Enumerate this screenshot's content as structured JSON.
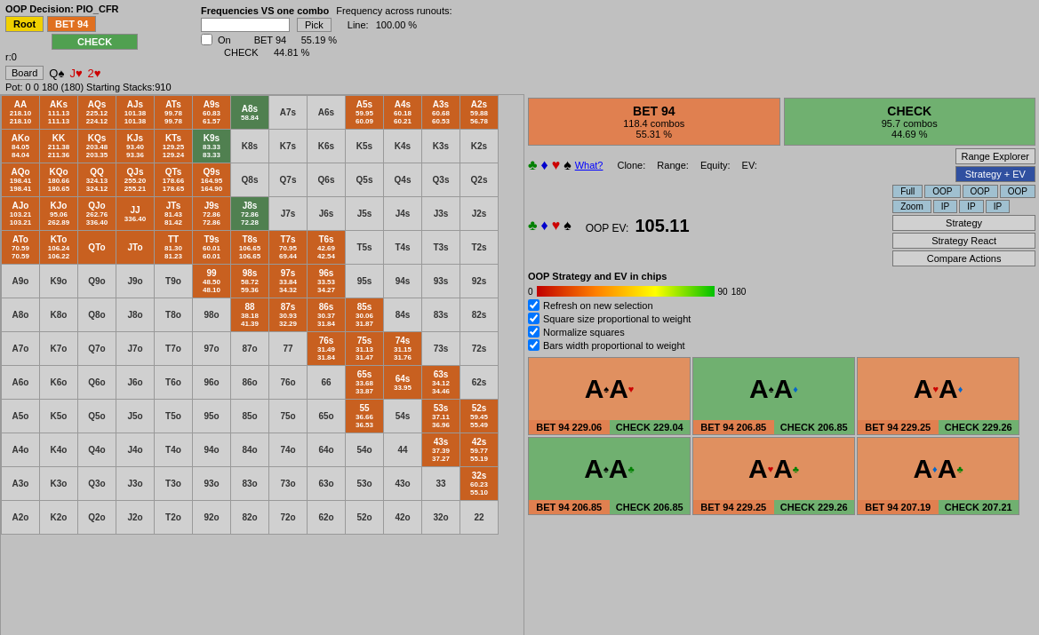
{
  "header": {
    "oop_decision": "OOP Decision: PIO_CFR",
    "round": "r:0",
    "pot_info": "Pot: 0 0 180 (180) Starting Stacks:910"
  },
  "action_buttons": {
    "root_label": "Root",
    "bet94_label": "BET 94",
    "check_label": "CHECK"
  },
  "board_controls": {
    "board_label": "Board",
    "q_spade": "Q♠",
    "j_heart": "J♥",
    "two_heart": "2♥"
  },
  "freq_bar": {
    "pick_label": "Pick",
    "line_label": "Line:",
    "line_value": "100.00 %",
    "on_label": "On",
    "bet94_freq": "55.19 %",
    "check_freq": "44.81 %",
    "bet94_label": "BET 94",
    "check_label": "CHECK",
    "freq_label": "Frequencies VS one combo",
    "freq_across": "Frequency across runouts:"
  },
  "action_stats": {
    "bet94": {
      "label": "BET 94",
      "combos": "118.4 combos",
      "pct": "55.31 %"
    },
    "check": {
      "label": "CHECK",
      "combos": "95.7 combos",
      "pct": "44.69 %"
    }
  },
  "oop_ev": {
    "label": "OOP EV:",
    "value": "105.11"
  },
  "clone_label": "Clone:",
  "range_label": "Range:",
  "equity_label": "Equity:",
  "ev_label": "EV:",
  "what_label": "What?",
  "range_buttons": {
    "full": "Full",
    "oop": "OOP",
    "ip": "IP",
    "zoom": "Zoom"
  },
  "side_buttons": {
    "range_explorer": "Range Explorer",
    "strategy_ev": "Strategy + EV",
    "strategy": "Strategy",
    "strategy_react": "Strategy React",
    "compare_actions": "Compare Actions"
  },
  "oop_strategy_label": "OOP Strategy and EV in chips",
  "bar": {
    "min": "0",
    "mid": "90",
    "max": "180"
  },
  "checkboxes": {
    "refresh": "Refresh on new selection",
    "square_size": "Square size proportional to weight",
    "normalize": "Normalize squares",
    "bars_width": "Bars width proportional to weight"
  },
  "card_combos": [
    {
      "top_card": "A♠A♥",
      "suit1": "spade",
      "suit2": "heart",
      "bet_label": "BET 94",
      "bet_val": "229.06",
      "check_label": "CHECK",
      "check_val": "229.04",
      "bg": "orange"
    },
    {
      "top_card": "A♠A♦",
      "suit1": "spade",
      "suit2": "diamond",
      "bet_label": "BET 94",
      "bet_val": "206.85",
      "check_label": "CHECK",
      "check_val": "206.85",
      "bg": "green"
    },
    {
      "top_card": "A♥A♦",
      "suit1": "heart",
      "suit2": "diamond",
      "bet_label": "BET 94",
      "bet_val": "229.25",
      "check_label": "CHECK",
      "check_val": "229.26",
      "bg": "orange"
    },
    {
      "top_card": "A♠A♣",
      "suit1": "spade",
      "suit2": "club",
      "bet_label": "BET 94",
      "bet_val": "206.85",
      "check_label": "CHECK",
      "check_val": "206.85",
      "bg": "green"
    },
    {
      "top_card": "A♥A♣",
      "suit1": "heart",
      "suit2": "club",
      "bet_label": "BET 94",
      "bet_val": "229.25",
      "check_label": "CHECK",
      "check_val": "229.26",
      "bg": "orange"
    },
    {
      "top_card": "A♦A♣",
      "suit1": "diamond",
      "suit2": "club",
      "bet_label": "BET 94",
      "bet_val": "207.19",
      "check_label": "CHECK",
      "check_val": "207.21",
      "bg": "orange"
    }
  ],
  "matrix": {
    "headers": [
      "AA",
      "AKs",
      "AQs",
      "AJs",
      "ATs",
      "A9s",
      "A8s",
      "A7s",
      "A6s",
      "A5s",
      "A4s",
      "A3s",
      "A2s"
    ],
    "rows": [
      {
        "label": "AA",
        "vals": [
          "218.10",
          "218.10",
          "111.13",
          "111.13",
          "225.12",
          "224.12",
          "101.38",
          "101.38",
          "99.78",
          "99.78",
          "60.83",
          "61.57",
          "58.84",
          "",
          "",
          "59.95",
          "60.09",
          "60.18",
          "60.21",
          "60.68",
          "60.53",
          "59.88",
          "56.78"
        ]
      },
      {
        "label": "AKo",
        "vals": [
          "84.05",
          "84.04",
          "211.38",
          "211.36",
          "203.48",
          "203.35",
          "93.40",
          "93.36",
          "129.25",
          "129.24",
          "83.33",
          "83.33",
          "",
          "",
          "",
          "",
          "",
          "",
          "",
          "",
          "",
          "",
          ""
        ]
      },
      {
        "label": "AQo",
        "vals": [
          "198.41",
          "198.41",
          "180.66",
          "180.65",
          "324.13",
          "324.12",
          "255.20",
          "255.21",
          "178.66",
          "178.65",
          "164.95",
          "164.90",
          "",
          "",
          "",
          "",
          "",
          "",
          "",
          "",
          "",
          "",
          ""
        ]
      },
      {
        "label": "AJo",
        "vals": [
          "103.21",
          "103.21",
          "95.06",
          "262.89",
          "262.76",
          "336.40",
          "336.40",
          "81.43",
          "81.42",
          "72.86",
          "72.86",
          "72.86",
          "72.28",
          "",
          "",
          "",
          "",
          "",
          "",
          "",
          "",
          "",
          ""
        ]
      },
      {
        "label": "ATo",
        "vals": [
          "70.59",
          "70.59",
          "106.24",
          "106.22",
          "QTo",
          "",
          "TT",
          "81.30",
          "81.23",
          "60.01",
          "60.01",
          "106.65",
          "106.65",
          "70.95",
          "69.44",
          "42.69",
          "42.54",
          "",
          "",
          "",
          "",
          "",
          ""
        ]
      },
      {
        "label": "A9o",
        "vals": [
          "",
          "",
          "",
          "",
          "",
          "",
          "",
          "",
          "",
          "",
          "99",
          "48.50",
          "48.10",
          "98s",
          "58.72",
          "59.36",
          "97s",
          "33.84",
          "34.32",
          "96s",
          "33.53",
          "34.27",
          "",
          "",
          "",
          "",
          "",
          "",
          "",
          ""
        ]
      },
      {
        "label": "A8o",
        "vals": [
          "",
          "",
          "",
          "",
          "",
          "",
          "",
          "",
          "",
          "",
          "",
          "",
          "88",
          "38.18",
          "41.39",
          "87s",
          "30.93",
          "32.29",
          "86s",
          "30.37",
          "31.84",
          "85s",
          "30.06",
          "31.87",
          "",
          "",
          "",
          "",
          "",
          ""
        ]
      },
      {
        "label": "A7o",
        "vals": [
          "",
          "",
          "",
          "",
          "",
          "",
          "",
          "",
          "",
          "",
          "",
          "",
          "",
          "",
          "76s",
          "31.49",
          "31.84",
          "75s",
          "31.13",
          "31.47",
          "74s",
          "31.15",
          "31.76",
          "",
          "",
          "",
          "",
          "",
          "",
          ""
        ]
      },
      {
        "label": "A6o",
        "vals": [
          "",
          "",
          "",
          "",
          "",
          "",
          "",
          "",
          "",
          "",
          "",
          "",
          "",
          "",
          "",
          "",
          "65s",
          "33.68",
          "33.87",
          "64s",
          "33.95",
          "",
          "63s",
          "34.12",
          "34.46",
          "",
          "",
          "",
          "",
          ""
        ]
      },
      {
        "label": "A5o",
        "vals": [
          "",
          "",
          "",
          "",
          "",
          "",
          "",
          "",
          "",
          "",
          "",
          "",
          "",
          "",
          "",
          "",
          "",
          "",
          "55",
          "36.66",
          "36.53",
          "53s",
          "37.11",
          "36.96",
          "52s",
          "59.45",
          "55.49",
          "",
          "",
          ""
        ]
      },
      {
        "label": "A4o",
        "vals": [
          "",
          "",
          "",
          "",
          "",
          "",
          "",
          "",
          "",
          "",
          "",
          "",
          "",
          "",
          "",
          "",
          "",
          "",
          "",
          "",
          "44",
          "",
          "43s",
          "37.39",
          "37.27",
          "42s",
          "59.77",
          "55.19",
          "",
          ""
        ]
      },
      {
        "label": "A3o",
        "vals": [
          "",
          "",
          "",
          "",
          "",
          "",
          "",
          "",
          "",
          "",
          "",
          "",
          "",
          "",
          "",
          "",
          "",
          "",
          "",
          "",
          "",
          "",
          "",
          "",
          "",
          "33",
          "",
          "",
          "32s",
          "60.23",
          "55.10"
        ]
      },
      {
        "label": "A2o",
        "vals": [
          "",
          "",
          "",
          "",
          "",
          "",
          "",
          "",
          "",
          "",
          "",
          "",
          "",
          "",
          "",
          "",
          "",
          "",
          "",
          "",
          "",
          "",
          "",
          "",
          "",
          "",
          "",
          "",
          "",
          "22",
          ""
        ]
      }
    ]
  }
}
